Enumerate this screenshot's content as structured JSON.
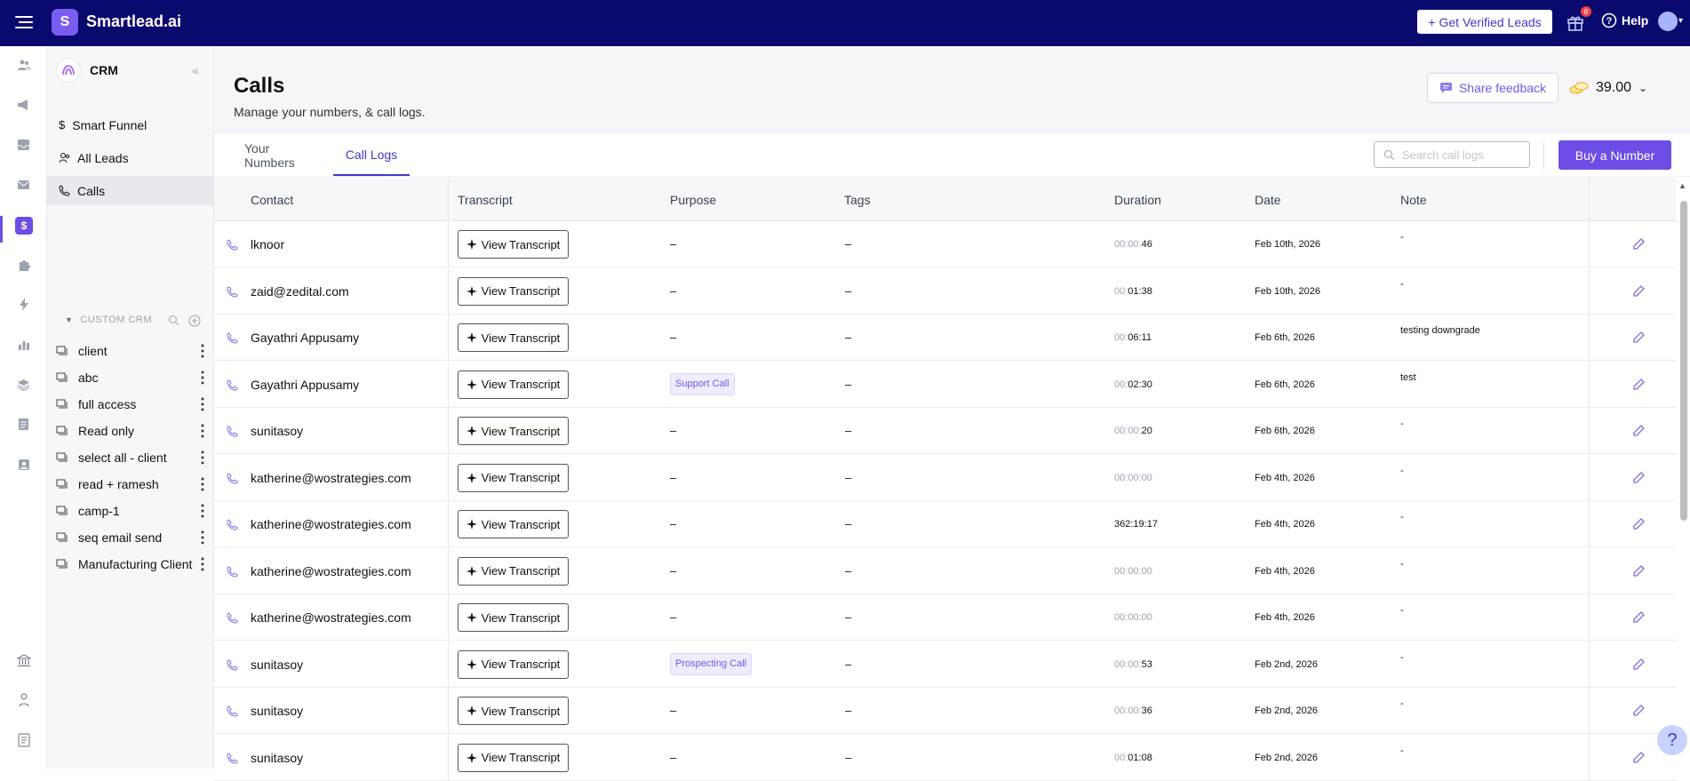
{
  "app": {
    "brand": "Smartlead.ai",
    "logo_letter": "S",
    "cta_label": "Get Verified Leads",
    "notification_count": "8",
    "help_label": "Help",
    "accent": "#6d4de6",
    "topbar_color": "#0a0a6e"
  },
  "rail": {
    "icons": [
      "users-icon",
      "megaphone-icon",
      "inbox-icon",
      "mail-icon",
      "dollar-icon",
      "puzzle-icon",
      "bolt-icon",
      "bar-chart-icon",
      "layers-icon",
      "document-icon",
      "contact-card-icon",
      "bank-icon",
      "person-network-icon",
      "notes-icon"
    ],
    "active": "dollar-icon"
  },
  "sidebar": {
    "title": "CRM",
    "items": [
      {
        "label": "Smart Funnel",
        "icon": "dollar-icon"
      },
      {
        "label": "All Leads",
        "icon": "users-icon"
      },
      {
        "label": "Calls",
        "icon": "phone-icon",
        "active": true
      }
    ],
    "custom_crm_label": "CUSTOM CRM",
    "custom_items": [
      "client",
      "abc",
      "full access",
      "Read only",
      "select all - client",
      "read + ramesh",
      "camp-1",
      "seq email send",
      "Manufacturing Client"
    ]
  },
  "page": {
    "title": "Calls",
    "subtitle": "Manage your numbers, & call logs.",
    "feedback_label": "Share feedback",
    "credits": "39.00"
  },
  "tabs": [
    {
      "label": "Your Numbers",
      "active": false
    },
    {
      "label": "Call Logs",
      "active": true
    }
  ],
  "search": {
    "placeholder": "Search call logs",
    "value": ""
  },
  "buy_label": "Buy a Number",
  "table": {
    "columns": [
      "Contact",
      "Transcript",
      "Purpose",
      "Tags",
      "Duration",
      "Date",
      "Note"
    ],
    "transcript_label": "View Transcript",
    "rows": [
      {
        "contact": "lknoor",
        "purpose": "–",
        "purpose_tag": false,
        "tags": "–",
        "dur_dim": "00:00:",
        "dur_main": "46",
        "date": "Feb 10th, 2026",
        "note": "-"
      },
      {
        "contact": "zaid@zedital.com",
        "purpose": "–",
        "purpose_tag": false,
        "tags": "–",
        "dur_dim": "00:",
        "dur_main": "01:38",
        "date": "Feb 10th, 2026",
        "note": "-"
      },
      {
        "contact": "Gayathri Appusamy",
        "purpose": "–",
        "purpose_tag": false,
        "tags": "–",
        "dur_dim": "00:",
        "dur_main": "06:11",
        "date": "Feb 6th, 2026",
        "note": "testing downgrade"
      },
      {
        "contact": "Gayathri Appusamy",
        "purpose": "Support Call",
        "purpose_tag": true,
        "tags": "–",
        "dur_dim": "00:",
        "dur_main": "02:30",
        "date": "Feb 6th, 2026",
        "note": "test"
      },
      {
        "contact": "sunitasoy",
        "purpose": "–",
        "purpose_tag": false,
        "tags": "–",
        "dur_dim": "00:00:",
        "dur_main": "20",
        "date": "Feb 6th, 2026",
        "note": "-"
      },
      {
        "contact": "katherine@wostrategies.com",
        "purpose": "–",
        "purpose_tag": false,
        "tags": "–",
        "dur_dim": "00:00:00",
        "dur_main": "",
        "date": "Feb 4th, 2026",
        "note": "-"
      },
      {
        "contact": "katherine@wostrategies.com",
        "purpose": "–",
        "purpose_tag": false,
        "tags": "–",
        "dur_dim": "",
        "dur_main": "362:19:17",
        "date": "Feb 4th, 2026",
        "note": "-"
      },
      {
        "contact": "katherine@wostrategies.com",
        "purpose": "–",
        "purpose_tag": false,
        "tags": "–",
        "dur_dim": "00:00:00",
        "dur_main": "",
        "date": "Feb 4th, 2026",
        "note": "-"
      },
      {
        "contact": "katherine@wostrategies.com",
        "purpose": "–",
        "purpose_tag": false,
        "tags": "–",
        "dur_dim": "00:00:00",
        "dur_main": "",
        "date": "Feb 4th, 2026",
        "note": "-"
      },
      {
        "contact": "sunitasoy",
        "purpose": "Prospecting Call",
        "purpose_tag": true,
        "tags": "–",
        "dur_dim": "00:00:",
        "dur_main": "53",
        "date": "Feb 2nd, 2026",
        "note": "-"
      },
      {
        "contact": "sunitasoy",
        "purpose": "–",
        "purpose_tag": false,
        "tags": "–",
        "dur_dim": "00:00:",
        "dur_main": "36",
        "date": "Feb 2nd, 2026",
        "note": "-"
      },
      {
        "contact": "sunitasoy",
        "purpose": "–",
        "purpose_tag": false,
        "tags": "–",
        "dur_dim": "00:",
        "dur_main": "01:08",
        "date": "Feb 2nd, 2026",
        "note": "-"
      }
    ]
  },
  "help_fab": "?"
}
